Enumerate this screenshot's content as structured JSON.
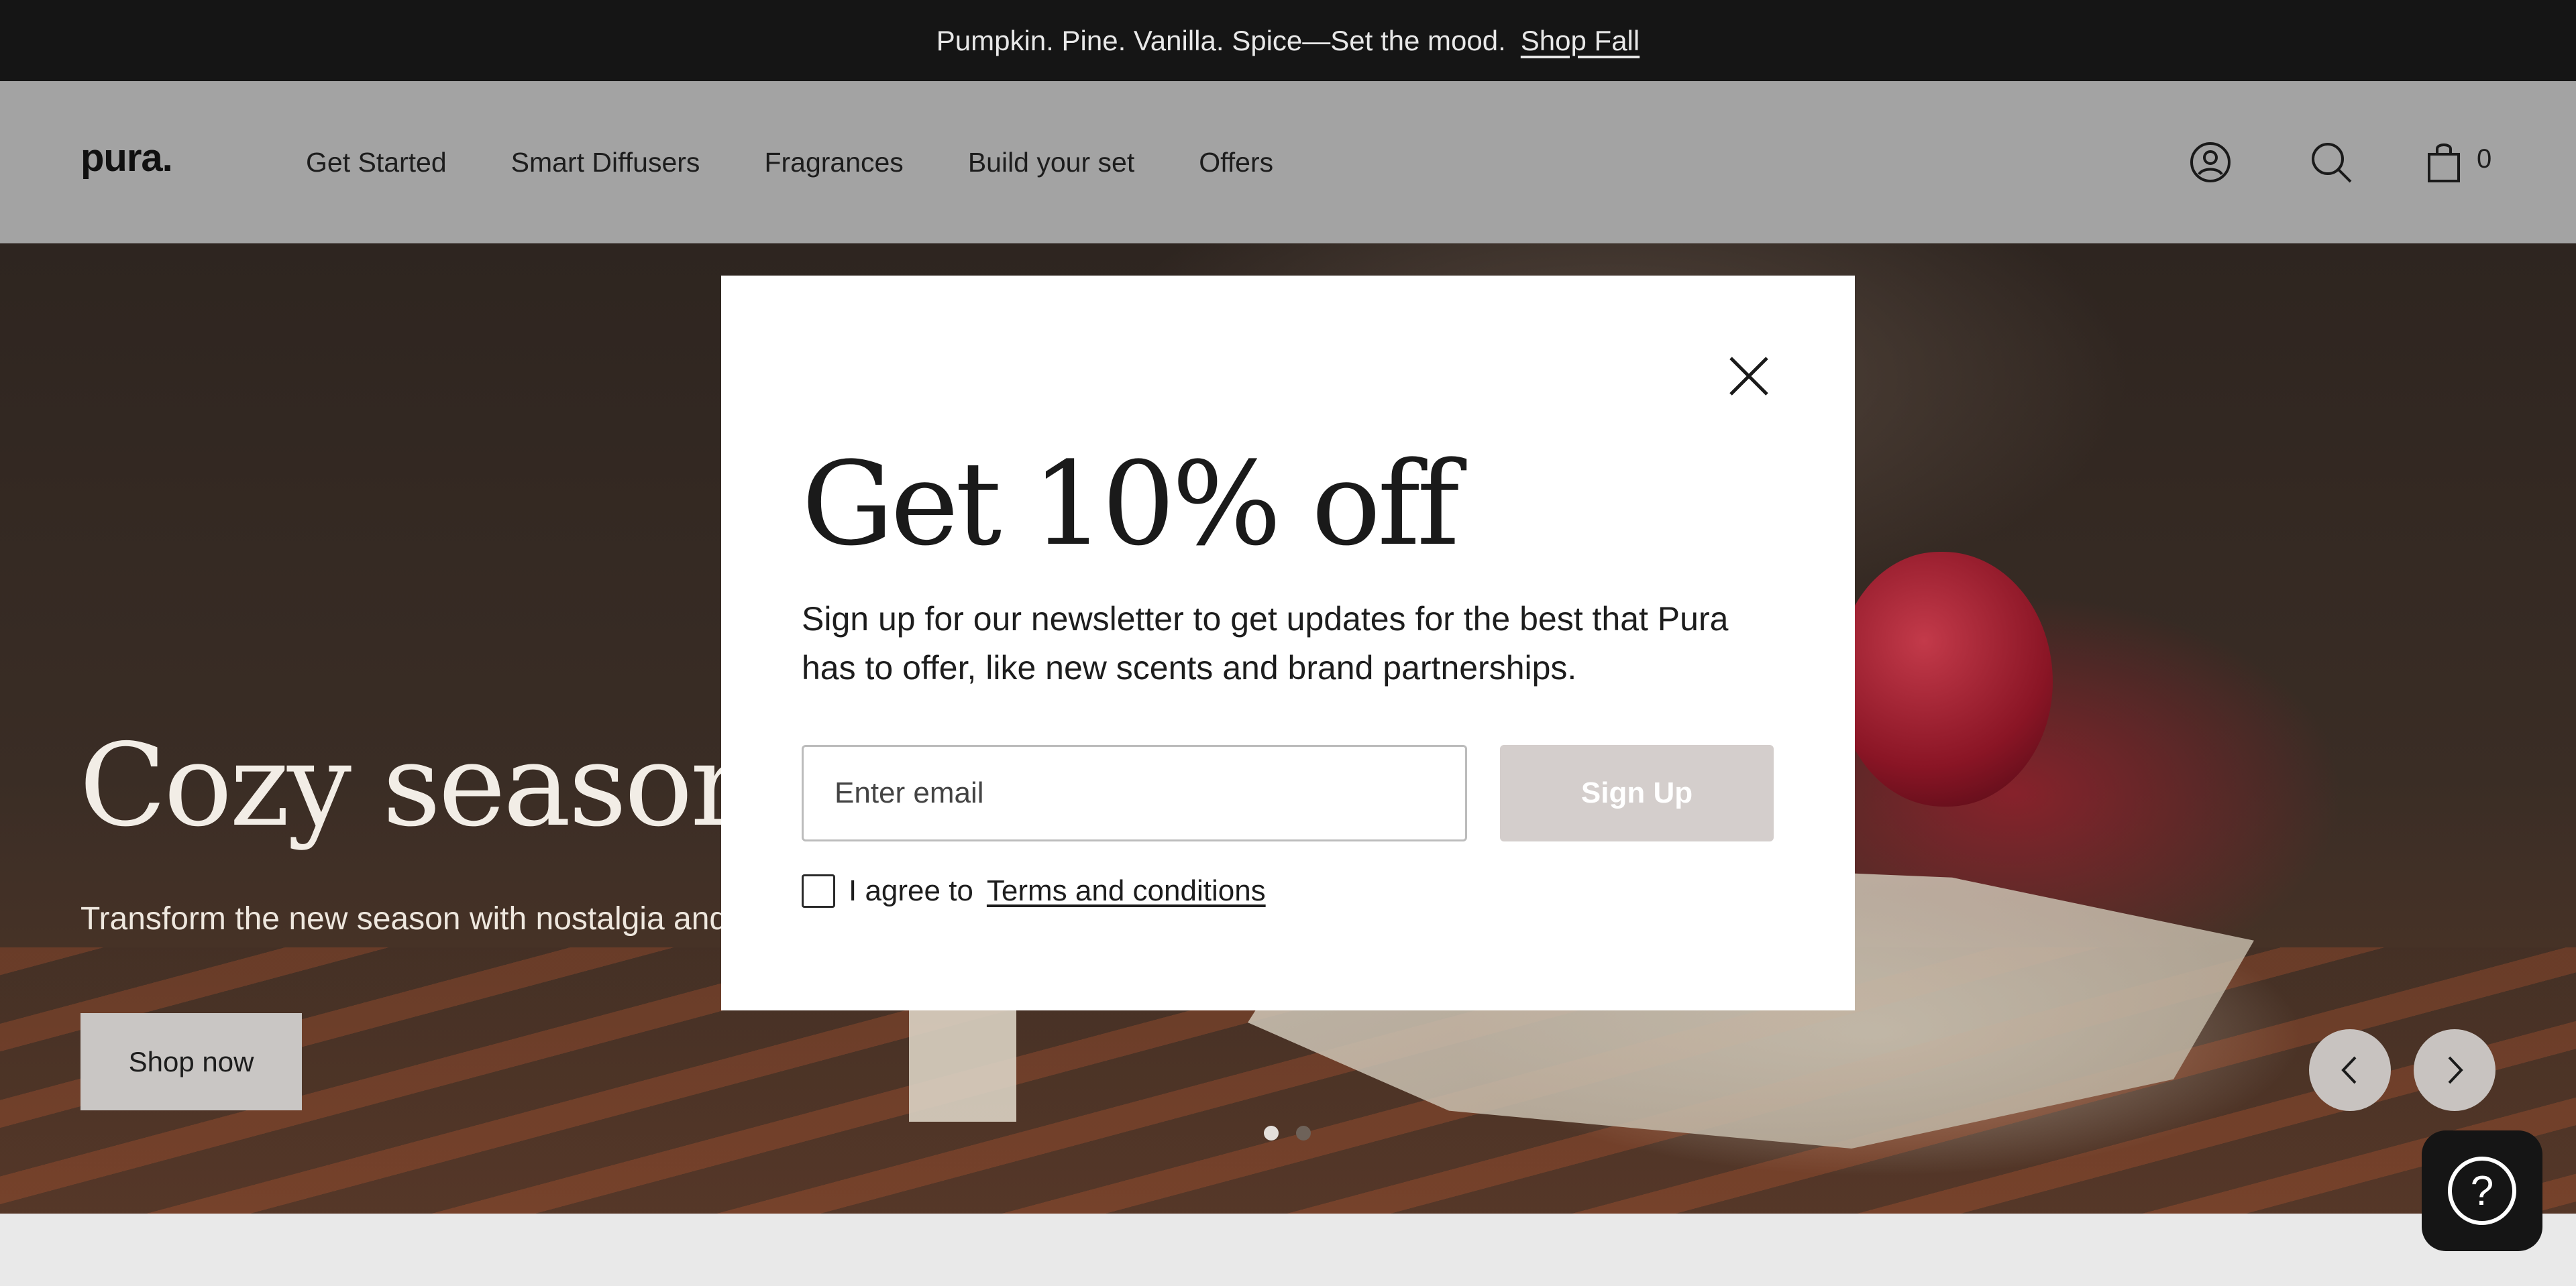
{
  "announcement": {
    "text": "Pumpkin. Pine. Vanilla. Spice—Set the mood.",
    "link": "Shop Fall"
  },
  "header": {
    "logo": "pura.",
    "nav": [
      "Get Started",
      "Smart Diffusers",
      "Fragrances",
      "Build your set",
      "Offers"
    ],
    "icons": [
      "account-icon",
      "search-icon",
      "cart-icon"
    ],
    "cart_count": "0"
  },
  "hero": {
    "title": "Cozy season",
    "subtitle": "Transform the new season with nostalgia and w",
    "cta": "Shop now",
    "slides_total": 2,
    "active_slide": 1
  },
  "modal": {
    "title": "Get 10% off",
    "body": "Sign up for our newsletter to get updates for the best that Pura has to offer, like new scents and brand partnerships.",
    "email_placeholder": "Enter email",
    "email_value": "",
    "signup_label": "Sign Up",
    "agree_text": "I agree to",
    "terms_link": "Terms and conditions",
    "agree_checked": false
  },
  "help": {
    "icon": "help-icon",
    "glyph": "?"
  },
  "colors": {
    "announcement_bg": "#151515",
    "header_bg": "#a3a3a3",
    "signup_button_bg": "#d4cecc",
    "help_button_bg": "#151515"
  }
}
